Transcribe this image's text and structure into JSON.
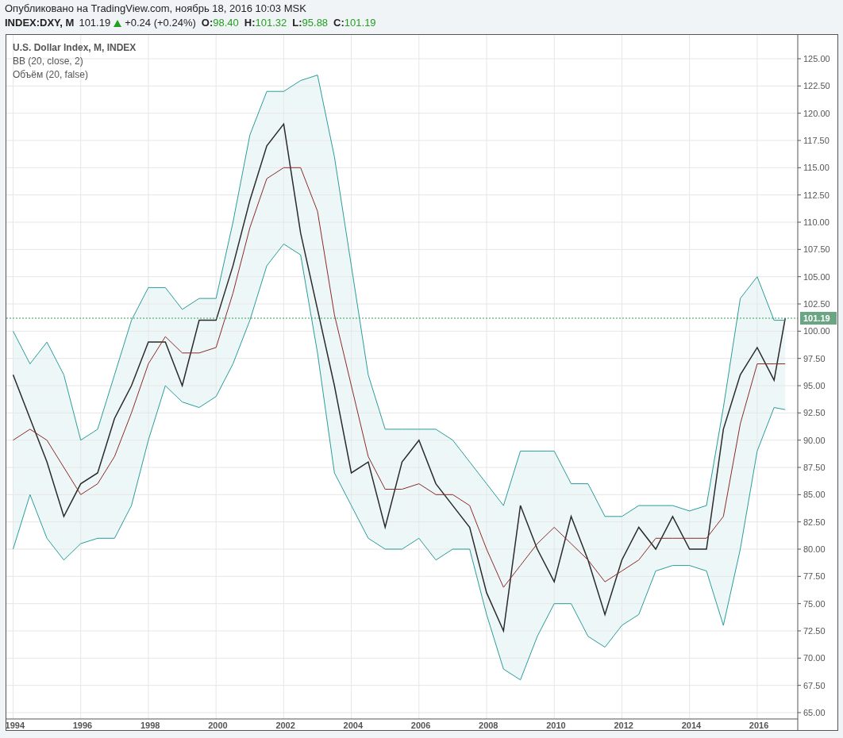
{
  "header": {
    "published": "Опубликовано на TradingView.com, ноябрь 18, 2016 10:03 MSK"
  },
  "quote": {
    "symbol": "INDEX:DXY, M",
    "last": "101.19",
    "rising": true,
    "change": "+0.24 (+0.24%)",
    "ohlc": [
      {
        "label": "O:",
        "value": "98.40"
      },
      {
        "label": "H:",
        "value": "101.32"
      },
      {
        "label": "L:",
        "value": "95.88"
      },
      {
        "label": "C:",
        "value": "101.19"
      }
    ]
  },
  "legend": [
    "U.S. Dollar Index, M, INDEX",
    "BB (20, close, 2)",
    "Объём (20, false)"
  ],
  "chart_data": {
    "type": "line",
    "grid": true,
    "xlim": [
      1993.8,
      2017.2
    ],
    "ref_lines": [
      {
        "axis": "y",
        "value": 101.19,
        "color": "#3a9a5a",
        "label": "101.19"
      }
    ],
    "x": [
      1994,
      1994.5,
      1995,
      1995.5,
      1996,
      1996.5,
      1997,
      1997.5,
      1998,
      1998.5,
      1999,
      1999.5,
      2000,
      2000.5,
      2001,
      2001.5,
      2002,
      2002.5,
      2003,
      2003.5,
      2004,
      2004.5,
      2005,
      2005.5,
      2006,
      2006.5,
      2007,
      2007.5,
      2008,
      2008.5,
      2009,
      2009.5,
      2010,
      2010.5,
      2011,
      2011.5,
      2012,
      2012.5,
      2013,
      2013.5,
      2014,
      2014.5,
      2015,
      2015.5,
      2016,
      2016.5,
      2016.83
    ],
    "series": [
      {
        "color": "#2b2b2b",
        "values": [
          96,
          92,
          88,
          83,
          86,
          87,
          92,
          95,
          99,
          99,
          95,
          101,
          101,
          106,
          112,
          117,
          119,
          109,
          102,
          95,
          87,
          88,
          82,
          88,
          90,
          86,
          84,
          82,
          76,
          72.5,
          84,
          80,
          77,
          83,
          79,
          74,
          79,
          82,
          80,
          83,
          80,
          80,
          91,
          96,
          98.5,
          95.5,
          101.19
        ]
      },
      {
        "color": "#2a9c9c",
        "values": [
          100,
          97,
          99,
          96,
          90,
          91,
          96,
          101,
          104,
          104,
          102,
          103,
          103,
          110,
          118,
          122,
          122,
          123,
          123.5,
          116,
          106,
          96,
          91,
          91,
          91,
          91,
          90,
          88,
          86,
          84,
          89,
          89,
          89,
          86,
          86,
          83,
          83,
          84,
          84,
          84,
          83.5,
          84,
          93,
          103,
          105,
          101,
          101
        ]
      },
      {
        "color": "#2a9c9c",
        "values": [
          80,
          85,
          81,
          79,
          80.5,
          81,
          81,
          84,
          90,
          95,
          93.5,
          93,
          94,
          97,
          101,
          106,
          108,
          107,
          98,
          87,
          84,
          81,
          80,
          80,
          81,
          79,
          80,
          80,
          74,
          69,
          68,
          72,
          75,
          75,
          72,
          71,
          73,
          74,
          78,
          78.5,
          78.5,
          78,
          73,
          80,
          89,
          93,
          92.8
        ]
      },
      {
        "color": "#8b2a2a",
        "values": [
          90,
          91,
          90,
          87.5,
          85,
          86,
          88.5,
          92.5,
          97,
          99.5,
          98,
          98,
          98.5,
          103.5,
          109.5,
          114,
          115,
          115,
          111,
          101.5,
          95,
          88.5,
          85.5,
          85.5,
          86,
          85,
          85,
          84,
          80,
          76.5,
          78.5,
          80.5,
          82,
          80.5,
          79,
          77,
          78,
          79,
          81,
          81,
          81,
          81,
          83,
          91.5,
          97,
          97,
          97
        ]
      }
    ],
    "xticks": [
      1994,
      1996,
      1998,
      2000,
      2002,
      2004,
      2006,
      2008,
      2010,
      2012,
      2014,
      2016
    ],
    "ylim": [
      65,
      125
    ],
    "yticks": [
      {
        "value": 65,
        "label": "65.00"
      },
      {
        "value": 67.5,
        "label": "67.50"
      },
      {
        "value": 70,
        "label": "70.00"
      },
      {
        "value": 72.5,
        "label": "72.50"
      },
      {
        "value": 75,
        "label": "75.00"
      },
      {
        "value": 77.5,
        "label": "77.50"
      },
      {
        "value": 80,
        "label": "80.00"
      },
      {
        "value": 82.5,
        "label": "82.50"
      },
      {
        "value": 85,
        "label": "85.00"
      },
      {
        "value": 87.5,
        "label": "87.50"
      },
      {
        "value": 90,
        "label": "90.00"
      },
      {
        "value": 92.5,
        "label": "92.50"
      },
      {
        "value": 95,
        "label": "95.00"
      },
      {
        "value": 97.5,
        "label": "97.50"
      },
      {
        "value": 100,
        "label": "100.00"
      },
      {
        "value": 102.5,
        "label": "102.50"
      },
      {
        "value": 105,
        "label": "105.00"
      },
      {
        "value": 107.5,
        "label": "107.50"
      },
      {
        "value": 110,
        "label": "110.00"
      },
      {
        "value": 112.5,
        "label": "112.50"
      },
      {
        "value": 115,
        "label": "115.00"
      },
      {
        "value": 117.5,
        "label": "117.50"
      },
      {
        "value": 120,
        "label": "120.00"
      },
      {
        "value": 122.5,
        "label": "122.50"
      },
      {
        "value": 125,
        "label": "125.00"
      }
    ]
  }
}
